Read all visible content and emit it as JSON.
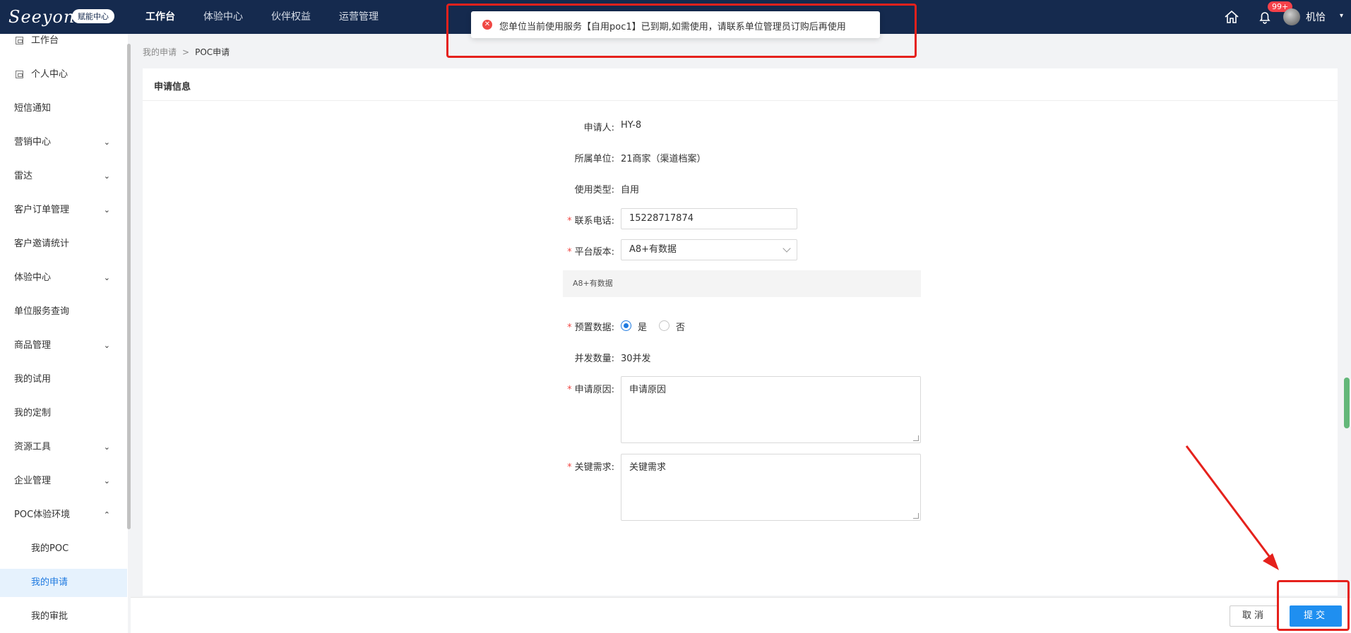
{
  "header": {
    "logo_text": "Seeyon",
    "logo_badge": "赋能中心",
    "nav": [
      "工作台",
      "体验中心",
      "伙伴权益",
      "运营管理"
    ],
    "notification_count": "99+",
    "username": "机恰"
  },
  "toast": {
    "message": "您单位当前使用服务【自用poc1】已到期,如需使用，请联系单位管理员订购后再使用"
  },
  "sidebar": {
    "items": [
      {
        "label": "工作台"
      },
      {
        "label": "个人中心"
      },
      {
        "label": "短信通知"
      },
      {
        "label": "营销中心"
      },
      {
        "label": "雷达"
      },
      {
        "label": "客户订单管理"
      },
      {
        "label": "客户邀请统计"
      },
      {
        "label": "体验中心"
      },
      {
        "label": "单位服务查询"
      },
      {
        "label": "商品管理"
      },
      {
        "label": "我的试用"
      },
      {
        "label": "我的定制"
      },
      {
        "label": "资源工具"
      },
      {
        "label": "企业管理"
      },
      {
        "label": "POC体验环境"
      },
      {
        "label": "我的POC"
      },
      {
        "label": "我的申请"
      },
      {
        "label": "我的审批"
      }
    ]
  },
  "breadcrumb": {
    "parent": "我的申请",
    "separator": ">",
    "current": "POC申请"
  },
  "form": {
    "section_title": "申请信息",
    "applicant_label": "申请人:",
    "applicant_value": "HY-8",
    "unit_label": "所属单位:",
    "unit_value": "21商家（渠道档案）",
    "usage_type_label": "使用类型:",
    "usage_type_value": "自用",
    "phone_label": "联系电话:",
    "phone_value": "15228717874",
    "platform_label": "平台版本:",
    "platform_value": "A8+有数据",
    "platform_hint": "A8+有数据",
    "preset_label": "预置数据:",
    "preset_yes": "是",
    "preset_no": "否",
    "concurrency_label": "并发数量:",
    "concurrency_value": "30并发",
    "reason_label": "申请原因:",
    "reason_value": "申请原因",
    "key_req_label": "关键需求:",
    "key_req_value": "关键需求",
    "required_mark": "*"
  },
  "footer": {
    "cancel_label": "取消",
    "submit_label": "提交"
  }
}
